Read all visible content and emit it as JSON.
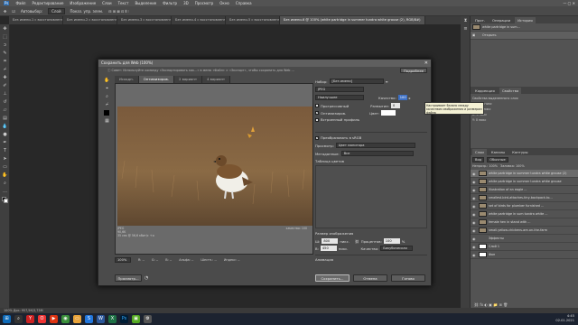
{
  "menu": [
    "Файл",
    "Редактирование",
    "Изображение",
    "Слои",
    "Текст",
    "Выделение",
    "Фильтр",
    "3D",
    "Просмотр",
    "Окно",
    "Справка"
  ],
  "options": {
    "auto_select": "Автовыбор:",
    "group": "Слой",
    "show_controls": "Показ. упр. элем."
  },
  "tabs": [
    {
      "label": "Без имени-1 с восстановленн..."
    },
    {
      "label": "Без имени-2 с восстановленн..."
    },
    {
      "label": "Без имени-3 с восстановленн..."
    },
    {
      "label": "Без имени-4 с восстановленн..."
    },
    {
      "label": "Без имени-5 с восстановленн..."
    },
    {
      "label": "Без имени-6 @ 100% (white partridge in summer tundra white grouse (2), RGB/8#)"
    }
  ],
  "dialog": {
    "title": "Сохранить для Web (100%)",
    "info": "Совет: Используйте команду «Экспортировать как...» в меню «Файл» > «Экспорт», чтобы сохранить для Web ...",
    "more": "Подробнее",
    "tabs": [
      "Исходн.",
      "Оптимизиров.",
      "2 вариант",
      "4 вариант"
    ],
    "preview_info_left": [
      "JPEG",
      "90,6K",
      "35 сек @ 56,6 кбит/с  +≡"
    ],
    "preview_info_right": "качество: 100",
    "preset_label": "Набор:",
    "preset_value": "[Без имени]",
    "format": "JPEG",
    "quality_mode": "Наилучшее",
    "quality_label": "Качество:",
    "quality_value": "100",
    "progressive": "Прогрессивный",
    "optimized": "Оптимизиров.",
    "embed_profile": "Встроенный профиль",
    "blur_label": "Размытие:",
    "blur_value": "0",
    "matte_label": "Цвет:",
    "convert_srgb": "Преобразовать в sRGB",
    "preview_label": "Просмотр:",
    "preview_value": "Цвет монитора",
    "metadata_label": "Метаданные:",
    "metadata_value": "Все",
    "color_table": "Таблица цветов",
    "image_size": "Размер изображения",
    "w_label": "Ш:",
    "w_value": "800",
    "h_label": "В:",
    "h_value": "450",
    "px": "пикс.",
    "percent_label": "Процентов:",
    "percent_value": "100",
    "quality2_label": "Качество:",
    "quality2_value": "Бикубическая",
    "animation": "Анимация",
    "zoom": "100%",
    "r_label": "R: --",
    "g_label": "G: --",
    "b_label": "B: --",
    "alpha_label": "Альфа: --",
    "hex_label": "Шестн.: --",
    "index_label": "Индекс: --",
    "btn_preview": "Просмотр...",
    "btn_save": "Сохранить...",
    "btn_cancel": "Отмена",
    "btn_done": "Готово"
  },
  "tooltip": "Настраивает баланс между качеством изображения и размером файла",
  "right_panel": {
    "history_tabs": [
      "Прот.",
      "Операции",
      "История"
    ],
    "history_items": [
      "white partridge in sum...",
      "Открыть"
    ],
    "adj_tabs": [
      "Коррекция",
      "Свойства"
    ],
    "props": [
      "Свойства выделенного слоя",
      "Ш: 800 пикс",
      "В: 450 пикс",
      "X: 0 пикс",
      "Y: 0 пикс"
    ],
    "layer_tabs": [
      "Слои",
      "Каналы",
      "Контуры"
    ],
    "layer_kind": "Вид",
    "layer_mode": "Обычные",
    "opacity": "Непрозр.: 100%",
    "fill": "Заливка: 100%",
    "layers": [
      "white partridge in summer tundra white grouse (2)",
      "white partridge in summer tundra white grouse",
      "Illustration of an eagle ...",
      "smallest-bird-attaches-tiny-backpack-to...",
      "set of birds for plumber furnished ...",
      "white partridge in sum tundra white ...",
      "female hen in stand with ...",
      "small-yellow-chickens-are-on-the-farm",
      "Эффекты",
      "Слой 1",
      "Фон"
    ]
  },
  "status": "100%   Док: 957,5К/3,73М",
  "clock": {
    "time": "4:45",
    "date": "02.01.2021"
  }
}
